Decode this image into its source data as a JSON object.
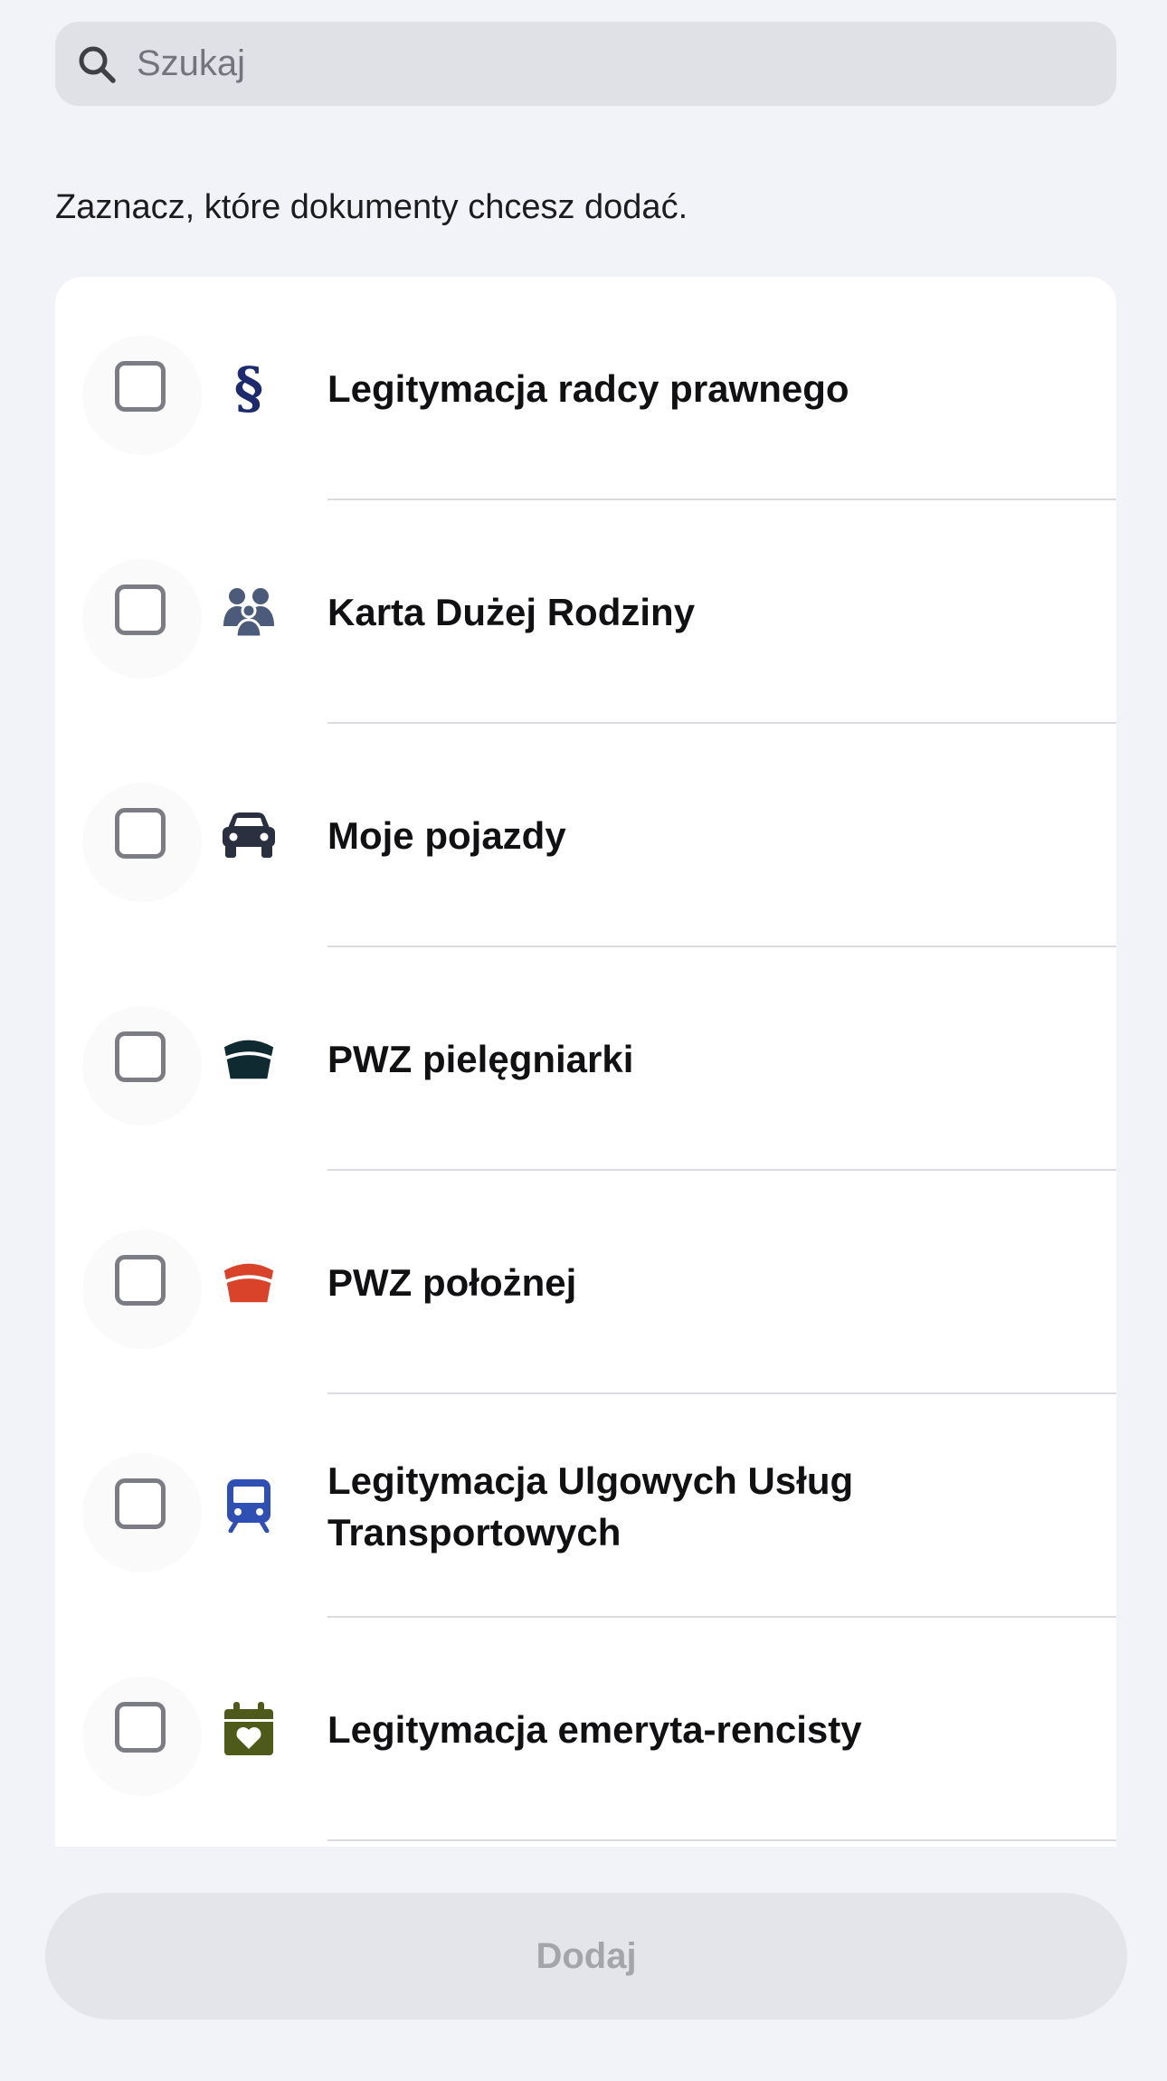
{
  "search": {
    "placeholder": "Szukaj"
  },
  "instruction": "Zaznacz, które dokumenty chcesz dodać.",
  "documents": [
    {
      "label": "Legitymacja radcy prawnego",
      "icon": "paragraph-icon",
      "icon_color": "#1e2a6e",
      "checked": false
    },
    {
      "label": "Karta Dużej Rodziny",
      "icon": "family-icon",
      "icon_color": "#4c5b7a",
      "checked": false
    },
    {
      "label": "Moje pojazdy",
      "icon": "car-icon",
      "icon_color": "#2b3040",
      "checked": false
    },
    {
      "label": "PWZ pielęgniarki",
      "icon": "nurse-cap-icon",
      "icon_color": "#0f2a30",
      "checked": false
    },
    {
      "label": "PWZ położnej",
      "icon": "midwife-cap-icon",
      "icon_color": "#d9432a",
      "checked": false
    },
    {
      "label": "Legitymacja Ulgowych Usług Transportowych",
      "icon": "train-icon",
      "icon_color": "#2f4fb5",
      "checked": false
    },
    {
      "label": "Legitymacja emeryta-rencisty",
      "icon": "calendar-heart-icon",
      "icon_color": "#4e5a1a",
      "checked": false
    }
  ],
  "footer": {
    "add_label": "Dodaj",
    "enabled": false
  }
}
